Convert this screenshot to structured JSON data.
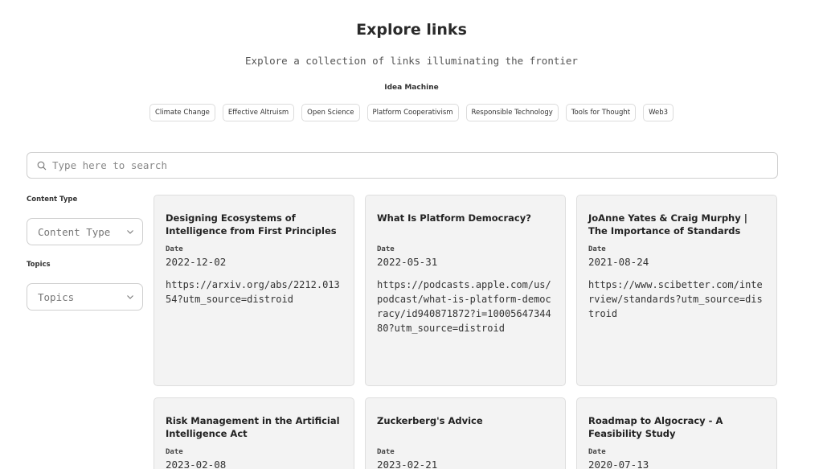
{
  "header": {
    "title": "Explore links",
    "subtitle": "Explore a collection of links illuminating the frontier",
    "group_label": "Idea Machine"
  },
  "tags": [
    "Climate Change",
    "Effective Altruism",
    "Open Science",
    "Platform Cooperativism",
    "Responsible Technology",
    "Tools for Thought",
    "Web3"
  ],
  "search": {
    "placeholder": "Type here to search",
    "value": ""
  },
  "filters": {
    "content_type_label": "Content Type",
    "content_type_placeholder": "Content Type",
    "topics_label": "Topics",
    "topics_placeholder": "Topics"
  },
  "cards": [
    {
      "title": "Designing Ecosystems of Intelligence from First Principles",
      "date_label": "Date",
      "date": "2022-12-02",
      "url": "https://arxiv.org/abs/2212.01354?utm_source=distroid"
    },
    {
      "title": "What Is Platform Democracy?",
      "date_label": "Date",
      "date": "2022-05-31",
      "url": "https://podcasts.apple.com/us/podcast/what-is-platform-democracy/id940871872?i=1000564734480?utm_source=distroid"
    },
    {
      "title": "JoAnne Yates & Craig Murphy | The Importance of Standards",
      "date_label": "Date",
      "date": "2021-08-24",
      "url": "https://www.scibetter.com/interview/standards?utm_source=distroid"
    },
    {
      "title": "Risk Management in the Artificial Intelligence Act",
      "date_label": "Date",
      "date": "2023-02-08",
      "url": ""
    },
    {
      "title": "Zuckerberg's Advice",
      "date_label": "Date",
      "date": "2023-02-21",
      "url": ""
    },
    {
      "title": "Roadmap to Algocracy - A Feasibility Study",
      "date_label": "Date",
      "date": "2020-07-13",
      "url": ""
    }
  ],
  "icons": {
    "search": "search-icon",
    "dropdown": "chevron-down-icon"
  }
}
